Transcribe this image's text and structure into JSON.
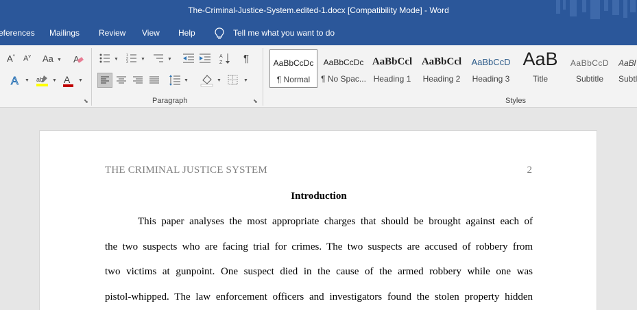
{
  "window": {
    "title": "The-Criminal-Justice-System.edited-1.docx  [Compatibility Mode]  -  Word"
  },
  "menu": {
    "items": [
      "eferences",
      "Mailings",
      "Review",
      "View",
      "Help"
    ],
    "tell_me": "Tell me what you want to do"
  },
  "ribbon": {
    "font_case_label": "Aa",
    "paragraph_label": "Paragraph",
    "styles_label": "Styles",
    "styles": [
      {
        "sample": "AaBbCcDc",
        "label": "¶ Normal"
      },
      {
        "sample": "AaBbCcDc",
        "label": "¶ No Spac..."
      },
      {
        "sample": "AaBbCcl",
        "label": "Heading 1"
      },
      {
        "sample": "AaBbCcl",
        "label": "Heading 2"
      },
      {
        "sample": "AaBbCcD",
        "label": "Heading 3"
      },
      {
        "sample": "AaB",
        "label": "Title"
      },
      {
        "sample": "AaBbCcD",
        "label": "Subtitle"
      },
      {
        "sample": "AaBl",
        "label": "Subtl"
      }
    ]
  },
  "document": {
    "running_head": "THE CRIMINAL JUSTICE SYSTEM",
    "page_number": "2",
    "heading": "Introduction",
    "lines": [
      "This paper analyses the most appropriate charges that should be brought against each of",
      "the two suspects who are facing trial for crimes. The two suspects are accused of robbery from",
      "two victims at gunpoint. One suspect died in the cause of the armed robbery while one was",
      "pistol-whipped. The law enforcement officers and investigators found the stolen property hidden"
    ]
  },
  "colors": {
    "accent": "#2b579a",
    "highlight": "#ffff00",
    "font_color": "#c00000"
  }
}
